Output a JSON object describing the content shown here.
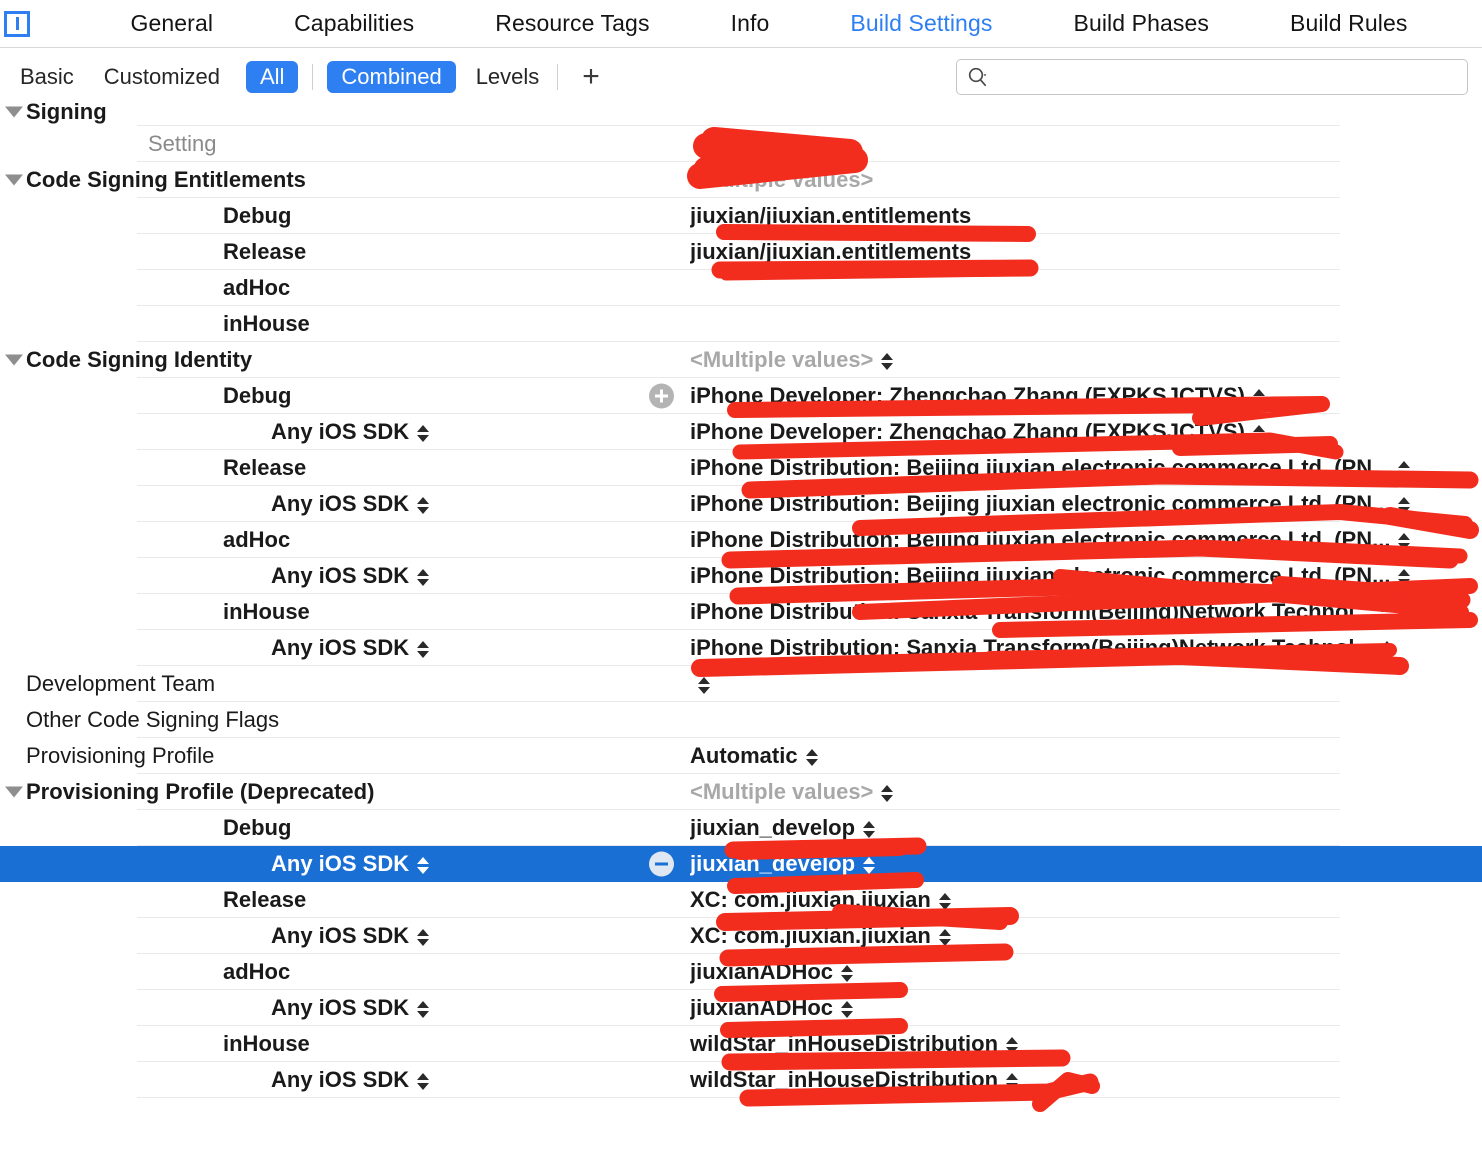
{
  "window": {
    "project_icon": "project-document-icon"
  },
  "tabbar": {
    "tabs": [
      {
        "label": "General",
        "active": false
      },
      {
        "label": "Capabilities",
        "active": false
      },
      {
        "label": "Resource Tags",
        "active": false
      },
      {
        "label": "Info",
        "active": false
      },
      {
        "label": "Build Settings",
        "active": true
      },
      {
        "label": "Build Phases",
        "active": false
      },
      {
        "label": "Build Rules",
        "active": false
      }
    ]
  },
  "filterbar": {
    "basic": "Basic",
    "customized": "Customized",
    "all": "All",
    "combined": "Combined",
    "levels": "Levels",
    "add": "+",
    "accent_color": "#2d7ff2"
  },
  "search": {
    "value": "",
    "placeholder": "",
    "icon": "search-icon"
  },
  "table": {
    "section_title": "Signing",
    "column_header": "Setting",
    "multiple_values": "<Multiple values>",
    "any_ios_sdk": "Any iOS SDK",
    "selection_color": "#1a6fd4",
    "rows": [
      {
        "kind": "section",
        "label": "Signing",
        "value": "",
        "triangle": true,
        "stepper": false,
        "value_stepper": false,
        "selected": false,
        "button": ""
      },
      {
        "kind": "header",
        "label": "Setting",
        "value": "",
        "triangle": false,
        "stepper": false,
        "value_stepper": false,
        "selected": false,
        "button": ""
      },
      {
        "kind": "group",
        "label": "Code Signing Entitlements",
        "value": "<Multiple values>",
        "triangle": true,
        "stepper": false,
        "value_stepper": false,
        "selected": false,
        "button": "",
        "muted": true
      },
      {
        "kind": "conf",
        "label": "Debug",
        "value": "jiuxian/jiuxian.entitlements",
        "triangle": false,
        "stepper": false,
        "value_stepper": false,
        "selected": false,
        "button": ""
      },
      {
        "kind": "conf",
        "label": "Release",
        "value": "jiuxian/jiuxian.entitlements",
        "triangle": false,
        "stepper": false,
        "value_stepper": false,
        "selected": false,
        "button": ""
      },
      {
        "kind": "conf",
        "label": "adHoc",
        "value": "",
        "triangle": false,
        "stepper": false,
        "value_stepper": false,
        "selected": false,
        "button": ""
      },
      {
        "kind": "conf",
        "label": "inHouse",
        "value": "",
        "triangle": false,
        "stepper": false,
        "value_stepper": false,
        "selected": false,
        "button": ""
      },
      {
        "kind": "group",
        "label": "Code Signing Identity",
        "value": "<Multiple values>",
        "triangle": true,
        "stepper": false,
        "value_stepper": true,
        "selected": false,
        "button": "",
        "muted": true
      },
      {
        "kind": "conf",
        "label": "Debug",
        "value": "iPhone Developer: Zhengchao Zhang (EXPKSJCTVS)",
        "triangle": false,
        "stepper": false,
        "value_stepper": true,
        "selected": false,
        "button": "plus"
      },
      {
        "kind": "sdk",
        "label": "Any iOS SDK",
        "value": "iPhone Developer: Zhengchao Zhang (EXPKSJCTVS)",
        "triangle": false,
        "stepper": true,
        "value_stepper": true,
        "selected": false,
        "button": ""
      },
      {
        "kind": "conf",
        "label": "Release",
        "value": "iPhone Distribution: Beijing jiuxian electronic commerce Ltd. (PN...",
        "triangle": false,
        "stepper": false,
        "value_stepper": true,
        "selected": false,
        "button": ""
      },
      {
        "kind": "sdk",
        "label": "Any iOS SDK",
        "value": "iPhone Distribution: Beijing jiuxian electronic commerce Ltd. (PN...",
        "triangle": false,
        "stepper": true,
        "value_stepper": true,
        "selected": false,
        "button": ""
      },
      {
        "kind": "conf",
        "label": "adHoc",
        "value": "iPhone Distribution: Beijing jiuxian electronic commerce Ltd. (PN...",
        "triangle": false,
        "stepper": false,
        "value_stepper": true,
        "selected": false,
        "button": ""
      },
      {
        "kind": "sdk",
        "label": "Any iOS SDK",
        "value": "iPhone Distribution: Beijing jiuxian electronic commerce Ltd. (PN...",
        "triangle": false,
        "stepper": true,
        "value_stepper": true,
        "selected": false,
        "button": ""
      },
      {
        "kind": "conf",
        "label": "inHouse",
        "value": "iPhone Distribution: Sanxia Transform(Beijing)Network Technol...",
        "triangle": false,
        "stepper": false,
        "value_stepper": true,
        "selected": false,
        "button": ""
      },
      {
        "kind": "sdk",
        "label": "Any iOS SDK",
        "value": "iPhone Distribution: Sanxia Transform(Beijing)Network Technol...",
        "triangle": false,
        "stepper": true,
        "value_stepper": true,
        "selected": false,
        "button": ""
      },
      {
        "kind": "plain",
        "label": "Development Team",
        "value": "",
        "triangle": false,
        "stepper": false,
        "value_stepper": true,
        "selected": false,
        "button": ""
      },
      {
        "kind": "plain",
        "label": "Other Code Signing Flags",
        "value": "",
        "triangle": false,
        "stepper": false,
        "value_stepper": false,
        "selected": false,
        "button": ""
      },
      {
        "kind": "plain",
        "label": "Provisioning Profile",
        "value": "Automatic",
        "triangle": false,
        "stepper": false,
        "value_stepper": true,
        "selected": false,
        "button": ""
      },
      {
        "kind": "group",
        "label": "Provisioning Profile (Deprecated)",
        "value": "<Multiple values>",
        "triangle": true,
        "stepper": false,
        "value_stepper": true,
        "selected": false,
        "button": "",
        "muted": true
      },
      {
        "kind": "conf",
        "label": "Debug",
        "value": "jiuxian_develop",
        "triangle": false,
        "stepper": false,
        "value_stepper": true,
        "selected": false,
        "button": ""
      },
      {
        "kind": "sdk",
        "label": "Any iOS SDK",
        "value": "jiuxian_develop",
        "triangle": false,
        "stepper": true,
        "value_stepper": true,
        "selected": true,
        "button": "minus"
      },
      {
        "kind": "conf",
        "label": "Release",
        "value": "XC: com.jiuxian.jiuxian",
        "triangle": false,
        "stepper": false,
        "value_stepper": true,
        "selected": false,
        "button": ""
      },
      {
        "kind": "sdk",
        "label": "Any iOS SDK",
        "value": "XC: com.jiuxian.jiuxian",
        "triangle": false,
        "stepper": true,
        "value_stepper": true,
        "selected": false,
        "button": ""
      },
      {
        "kind": "conf",
        "label": "adHoc",
        "value": "jiuxianADHoc",
        "triangle": false,
        "stepper": false,
        "value_stepper": true,
        "selected": false,
        "button": ""
      },
      {
        "kind": "sdk",
        "label": "Any iOS SDK",
        "value": "jiuxianADHoc",
        "triangle": false,
        "stepper": true,
        "value_stepper": true,
        "selected": false,
        "button": ""
      },
      {
        "kind": "conf",
        "label": "inHouse",
        "value": "wildStar_inHouseDistribution",
        "triangle": false,
        "stepper": false,
        "value_stepper": true,
        "selected": false,
        "button": ""
      },
      {
        "kind": "sdk",
        "label": "Any iOS SDK",
        "value": "wildStar_inHouseDistribution",
        "triangle": false,
        "stepper": true,
        "value_stepper": true,
        "selected": false,
        "button": ""
      }
    ]
  },
  "annotations": {
    "color": "#f22d1e",
    "description": "red marker strike-through redactions over sensitive values"
  }
}
